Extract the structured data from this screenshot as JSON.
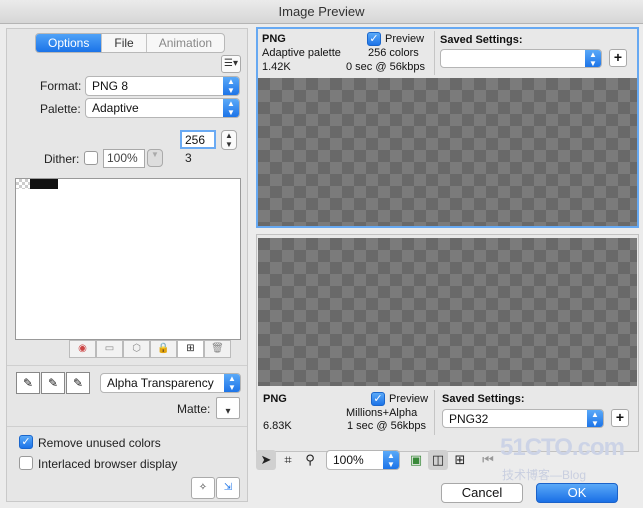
{
  "window": {
    "title": "Image Preview"
  },
  "tabs": [
    {
      "label": "Options"
    },
    {
      "label": "File"
    },
    {
      "label": "Animation"
    }
  ],
  "options": {
    "format_label": "Format:",
    "format_value": "PNG 8",
    "palette_label": "Palette:",
    "palette_value": "Adaptive",
    "colors_value": "256",
    "colors_count": "3",
    "dither_label": "Dither:",
    "dither_value": "100%",
    "transparency_value": "Alpha Transparency",
    "matte_label": "Matte:",
    "remove_unused_label": "Remove unused colors",
    "interlaced_label": "Interlaced browser display"
  },
  "preview_top": {
    "format": "PNG",
    "palette": "Adaptive palette",
    "size": "1.42K",
    "preview_label": "Preview",
    "colors": "256 colors",
    "speed": "0 sec @ 56kbps",
    "saved_settings_label": "Saved Settings:",
    "saved_settings_value": ""
  },
  "preview_bottom": {
    "format": "PNG",
    "preview_label": "Preview",
    "colors": "Millions+Alpha",
    "size": "6.83K",
    "speed": "1 sec @ 56kbps",
    "saved_settings_label": "Saved Settings:",
    "saved_settings_value": "PNG32"
  },
  "toolbar": {
    "zoom_value": "100%"
  },
  "buttons": {
    "cancel_label": "Cancel",
    "ok_label": "OK"
  },
  "watermark": {
    "site": "51CTO.com",
    "sub": "技术博客—Blog"
  },
  "icons": {
    "menu": "list-menu-icon",
    "pointer": "pointer-icon",
    "crop": "crop-icon",
    "zoom": "magnifier-icon"
  }
}
